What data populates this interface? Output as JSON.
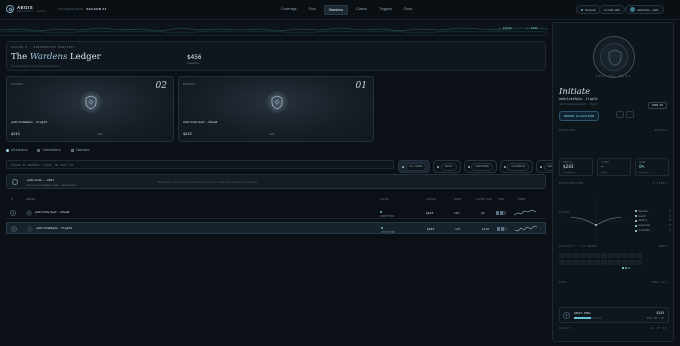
{
  "brand": {
    "name": "AEGIS",
    "sub": "PROTOCOL · VAULT"
  },
  "season": {
    "label": "GOVERNANCE",
    "value": "SEASON 01"
  },
  "nav": [
    "Coverage",
    "Pool",
    "Wardens",
    "Claims",
    "Triggers",
    "Docs"
  ],
  "topright": {
    "network": "Network",
    "amount": "10,000 AEG",
    "wallet": "addr1a4e...e9d1"
  },
  "ticker": {
    "values": [
      "+ $2946",
      "+ $48k"
    ]
  },
  "hero": {
    "eyebrow": "SEASON 2 · UNDERWRITER RANKINGS",
    "title_pre": "The",
    "title_em": "Wardens",
    "title_post": "Ledger",
    "desc": "The underwriters of the Aegis reserve pool",
    "stat_value": "$456",
    "stat_label": "2 wardens"
  },
  "cards": [
    {
      "rank": "02",
      "label": "WARDEN",
      "addr": "addr1x4e9q2x..tlqp7d",
      "tag": "",
      "capital": "$243",
      "mini": "12%"
    },
    {
      "rank": "01",
      "label": "WARDEN",
      "addr": "addr1x9vrpaf..k5wo0",
      "tag": "",
      "capital": "$413",
      "mini": "12%"
    }
  ],
  "tabs": [
    "All wardens",
    "Underwriters",
    "Claimants"
  ],
  "search": {
    "placeholder": "SEARCH BY ADDRESS, STAKE, OR VAULT ID"
  },
  "filters": [
    "ALL TIERS",
    "BASIC",
    "CERTIFIED",
    "GUARDIAN",
    "SENTRY",
    "INITIATE"
  ],
  "banner": {
    "who": "addr1x4e...e9d1",
    "meta": "Not yet on the Warden Ledger · allocate to join",
    "hint": "Add liquidity to the reserve pool to become an active underwriter and earn protocol fees."
  },
  "table": {
    "headers": [
      "#",
      "WARDEN",
      "STATUS",
      "CAPITAL",
      "SHARE",
      "CLAIMS PAID",
      "TIER",
      "TREND"
    ],
    "rows": [
      {
        "rank": "1",
        "addr": "addr1x9vrpaf..k5wo0",
        "sub": "—",
        "status": "CERTIFIED",
        "capital": "$413",
        "share": "12%",
        "paid": "$0",
        "menu": "›"
      },
      {
        "rank": "2",
        "addr": "addr1x4e9q2x..tlqp7d",
        "sub": "—",
        "status": "CERTIFIED",
        "capital": "$243",
        "share": "12%",
        "paid": "$120",
        "menu": "›"
      }
    ]
  },
  "sidebar": {
    "emblem_caption": "SEA TO REST",
    "title": "Initiate",
    "addr": "addr1x4e9q2x..tlqp7d",
    "line": "addr1x4e9q2x9pqeq8t..t3qp7d",
    "badge": "RANK #2",
    "action": "MIRROR ALLOCATIONS",
    "sec_perf": "POSITION",
    "sec_perf_r": "SEASON",
    "kpis": [
      {
        "label": "CAPITAL",
        "value": "$243",
        "sub": "≈ 4 positions"
      },
      {
        "label": "CLAIMS",
        "value": "—",
        "sub": "0 paid"
      },
      {
        "label": "SHARE",
        "value": "0%",
        "sub": "of reserve"
      }
    ],
    "sec_dist": "DISTRIBUTION",
    "sec_dist_r": "5 TIERS",
    "legend": [
      {
        "name": "Sponsor",
        "val": "0"
      },
      {
        "name": "Guard",
        "val": "0"
      },
      {
        "name": "Sentry",
        "val": "0"
      },
      {
        "name": "Guardian",
        "val": "0"
      },
      {
        "name": "Initiate",
        "val": "1"
      }
    ],
    "chart_label": "Initiate",
    "sec_hist": "ACTIVITY · 12 WEEKS",
    "sec_hist_r": "WEEK",
    "sec_pool": "POOL",
    "sec_pool_r": "VIEW ALL",
    "pool": {
      "icon": "A",
      "name": "AEGIS POOL",
      "value": "$243",
      "tag": "POOL FEE 1.2%"
    },
    "sec_foot": "VAULTS",
    "sec_foot_r": "26 OF 26"
  },
  "colors": {
    "accent": "#7fd0e6",
    "green": "#6fb8a3",
    "bg": "#0b1016"
  }
}
